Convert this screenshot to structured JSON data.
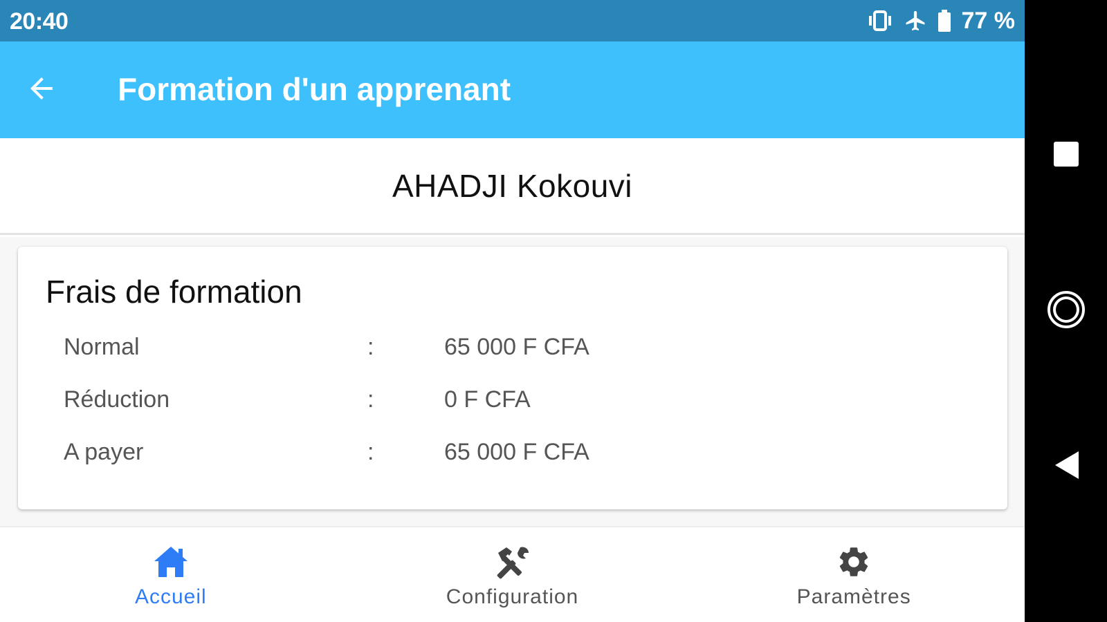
{
  "status_bar": {
    "time": "20:40",
    "battery_text": "77 %",
    "icons": [
      "vibrate-icon",
      "airplane-mode-icon",
      "battery-icon"
    ]
  },
  "app_bar": {
    "title": "Formation d'un apprenant",
    "back_icon": "arrow-left-icon",
    "color": "#3dc0fb"
  },
  "student": {
    "name": "AHADJI Kokouvi"
  },
  "fees": {
    "title": "Frais de formation",
    "rows": [
      {
        "label": "Normal",
        "separator": ":",
        "value": "65 000 F CFA"
      },
      {
        "label": "Réduction",
        "separator": ":",
        "value": "0 F CFA"
      },
      {
        "label": "A payer",
        "separator": ":",
        "value": "65 000 F CFA"
      }
    ]
  },
  "bottom_nav": {
    "items": [
      {
        "label": "Accueil",
        "icon": "home-icon",
        "active": true
      },
      {
        "label": "Configuration",
        "icon": "tools-icon",
        "active": false
      },
      {
        "label": "Paramètres",
        "icon": "gear-icon",
        "active": false
      }
    ],
    "active_color": "#2f7df6"
  },
  "system_nav": {
    "buttons": [
      "recents-square-icon",
      "home-circle-icon",
      "back-triangle-icon"
    ]
  }
}
